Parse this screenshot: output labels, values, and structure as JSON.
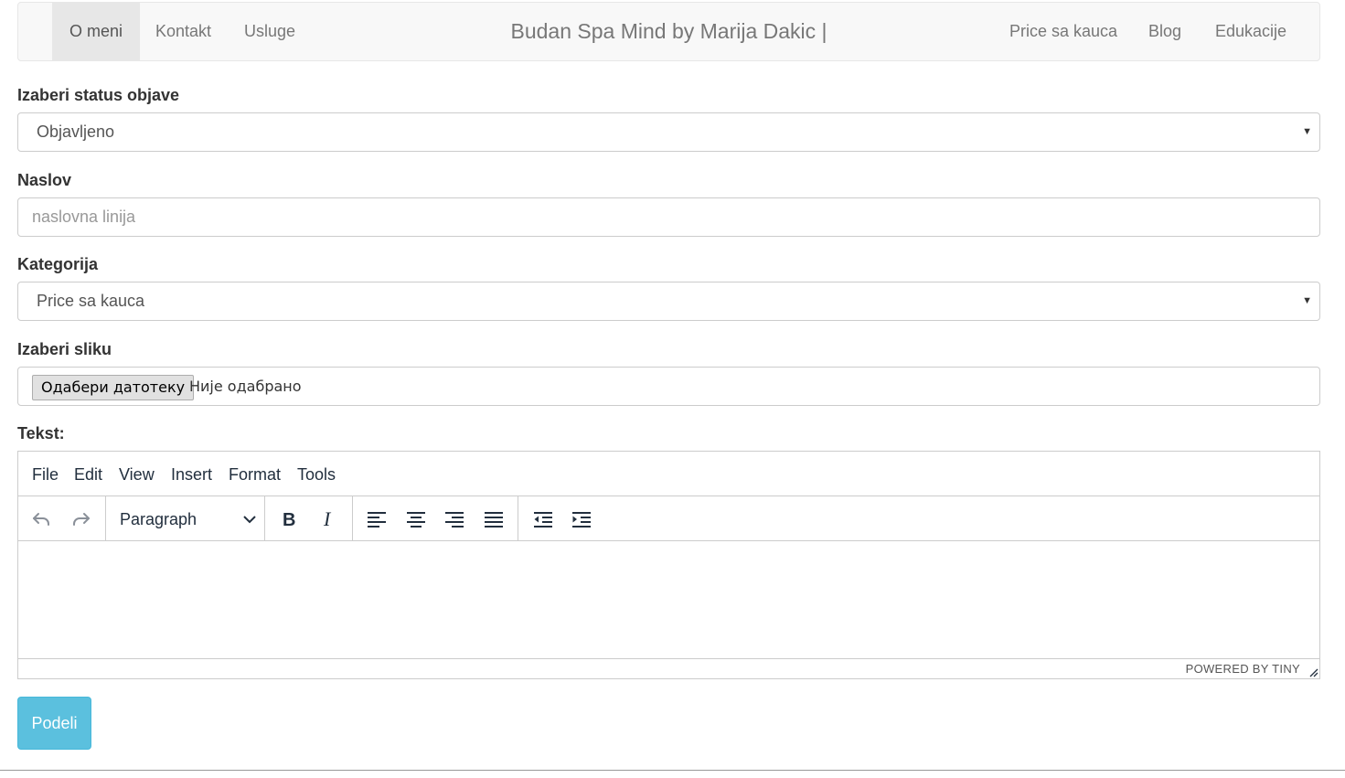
{
  "navbar": {
    "left_items": [
      "O meni",
      "Kontakt",
      "Usluge"
    ],
    "brand": "Budan Spa Mind by Marija Dakic |",
    "right_items": [
      "Price sa kauca",
      "Blog",
      "Edukacije"
    ]
  },
  "form": {
    "status": {
      "label": "Izaberi status objave",
      "value": "Objavljeno"
    },
    "title": {
      "label": "Naslov",
      "placeholder": "naslovna linija"
    },
    "category": {
      "label": "Kategorija",
      "value": "Price sa kauca"
    },
    "image": {
      "label": "Izaberi sliku",
      "button": "Одабери датотеку",
      "status": "Није одабрано"
    },
    "text": {
      "label": "Tekst:"
    },
    "submit": "Podeli"
  },
  "editor": {
    "menu": [
      "File",
      "Edit",
      "View",
      "Insert",
      "Format",
      "Tools"
    ],
    "block_format": "Paragraph",
    "branding": "POWERED BY TINY",
    "toolbar_icons": [
      "undo-icon",
      "redo-icon",
      "bold-icon",
      "italic-icon",
      "align-left-icon",
      "align-center-icon",
      "align-right-icon",
      "align-justify-icon",
      "outdent-icon",
      "indent-icon"
    ]
  },
  "colors": {
    "accent": "#5bc0de",
    "navbar_bg": "#f8f8f8",
    "active_nav_bg": "#e7e7e7"
  }
}
